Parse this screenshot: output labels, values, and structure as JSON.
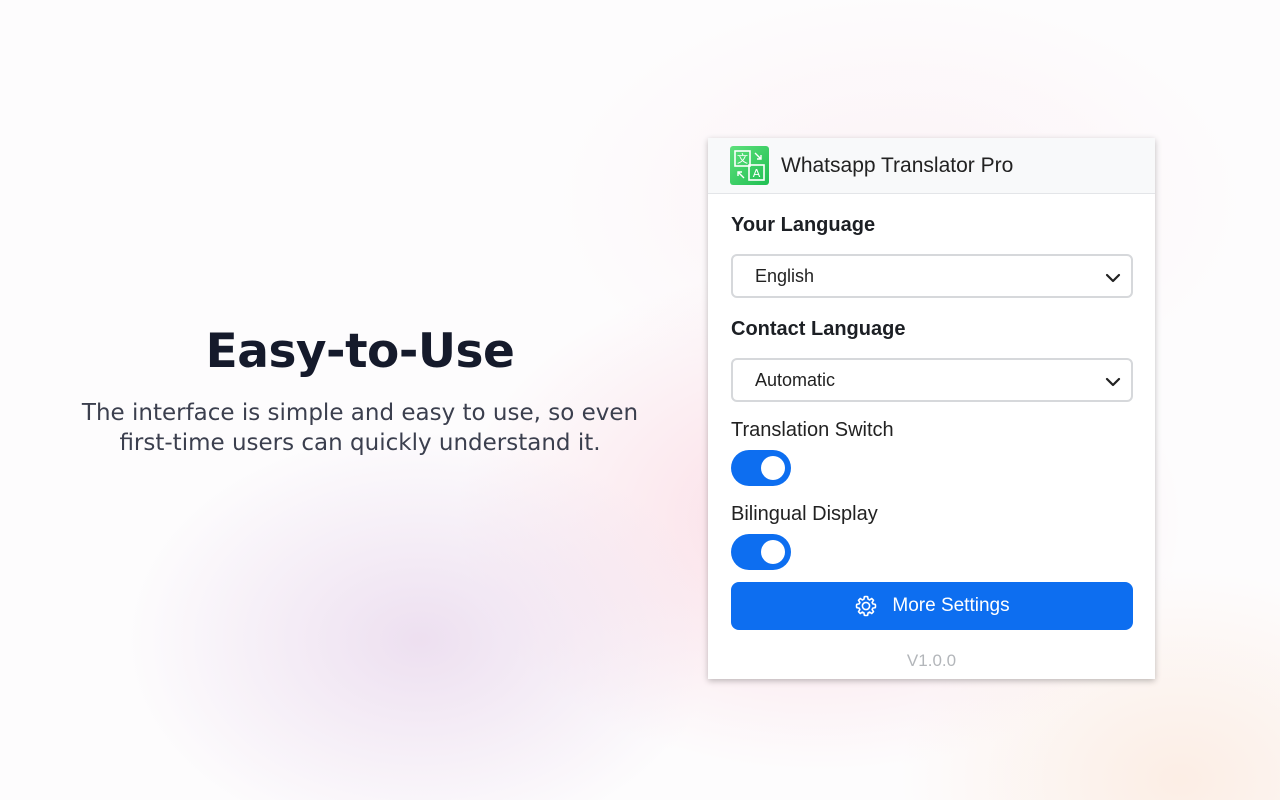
{
  "hero": {
    "title": "Easy-to-Use",
    "description": "The interface is simple and easy to use, so even first-time users can quickly understand it."
  },
  "popup": {
    "app_title": "Whatsapp Translator Pro",
    "logo_icon": "translate-icon",
    "your_language": {
      "label": "Your Language",
      "selected": "English"
    },
    "contact_language": {
      "label": "Contact Language",
      "selected": "Automatic"
    },
    "translation_switch": {
      "label": "Translation Switch",
      "enabled": true
    },
    "bilingual_display": {
      "label": "Bilingual Display",
      "enabled": true
    },
    "more_settings": {
      "label": "More Settings",
      "icon": "gear-icon"
    },
    "version": "V1.0.0"
  },
  "colors": {
    "accent": "#0d6ef0",
    "logo_green": "#22c55e",
    "heading": "#151a2b"
  }
}
